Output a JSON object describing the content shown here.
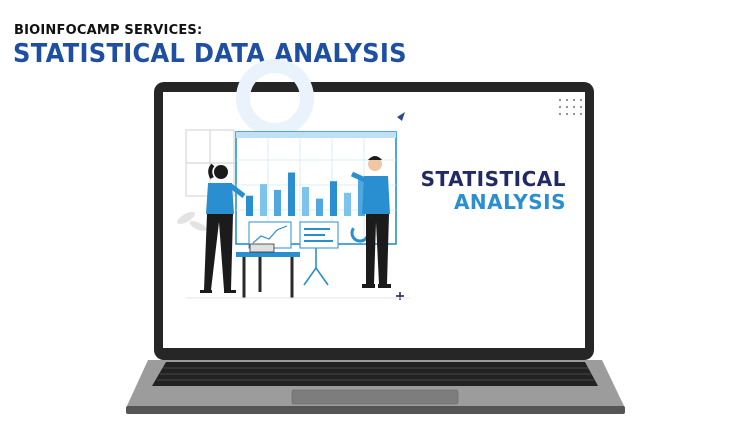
{
  "header": {
    "eyebrow": "BIOINFOCAMP SERVICES:",
    "title": "STATISTICAL DATA ANALYSIS"
  },
  "screen": {
    "title_line1": "STATISTICAL",
    "title_line2": "ANALYSIS"
  },
  "colors": {
    "brand_blue": "#1f4fa3",
    "navy": "#222a66",
    "accent_blue": "#2a8fd1",
    "laptop_body": "#2b2b2b",
    "keyboard_base": "#9a9a9a"
  },
  "chart": {
    "bar_levels": [
      0.35,
      0.55,
      0.45,
      0.75,
      0.5,
      0.3,
      0.6,
      0.4,
      0.65,
      0.55
    ]
  },
  "icons": [
    "monitor-icon",
    "plus-icon",
    "arrow-icon"
  ]
}
